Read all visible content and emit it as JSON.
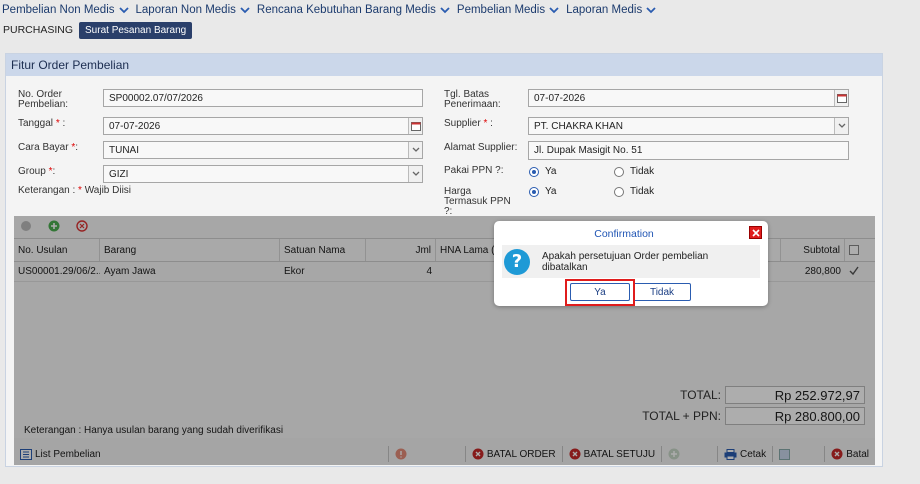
{
  "menu": {
    "items": [
      "Pembelian Non Medis",
      "Laporan Non Medis",
      "Rencana Kebutuhan Barang Medis",
      "Pembelian Medis",
      "Laporan Medis"
    ]
  },
  "subbar": {
    "section": "PURCHASING",
    "active_tab": "Surat Pesanan Barang"
  },
  "panel": {
    "title": "Fitur Order Pembelian"
  },
  "form": {
    "no_order_label": "No. Order Pembelian:",
    "no_order_value": "SP00002.07/07/2026",
    "tanggal_label": "Tanggal",
    "tanggal_value": "07-07-2026",
    "cara_bayar_label": "Cara Bayar",
    "cara_bayar_value": "TUNAI",
    "group_label": "Group",
    "group_value": "GIZI",
    "keterangan_label": "Keterangan :",
    "wajib_diisi": "Wajib Diisi",
    "tgl_batas_label": "Tgl. Batas Penerimaan:",
    "tgl_batas_value": "07-07-2026",
    "supplier_label": "Supplier",
    "supplier_value": "PT. CHAKRA KHAN",
    "alamat_label": "Alamat Supplier:",
    "alamat_value": "Jl. Dupak Masigit No. 51",
    "pakai_ppn_label": "Pakai PPN ?:",
    "harga_ppn_label": "Harga Termasuk PPN ?:",
    "opt_ya": "Ya",
    "opt_tidak": "Tidak",
    "required_mark": "*",
    "colon": ":"
  },
  "grid": {
    "columns": [
      "No. Usulan",
      "Barang",
      "Satuan Nama",
      "Jml",
      "HNA Lama (",
      "Subtotal"
    ],
    "rows": [
      {
        "no_usulan": "US00001.29/06/2...",
        "barang": "Ayam Jawa",
        "satuan": "Ekor",
        "jml": "4",
        "subtotal": "280,800"
      }
    ],
    "total_label": "TOTAL:",
    "total_value": "Rp 252.972,97",
    "total_ppn_label": "TOTAL + PPN:",
    "total_ppn_value": "Rp 280.800,00",
    "note": "Keterangan : Hanya usulan barang yang sudah diverifikasi"
  },
  "bottombar": {
    "list": "List Pembelian",
    "batal_order": "BATAL ORDER",
    "batal_setuju": "BATAL SETUJU",
    "cetak": "Cetak",
    "batal": "Batal"
  },
  "dialog": {
    "title": "Confirmation",
    "message": "Apakah persetujuan Order pembelian dibatalkan",
    "yes": "Ya",
    "no": "Tidak"
  },
  "colors": {
    "accent": "#2a3f6a",
    "danger": "#e01c1c",
    "info": "#1f9ad6"
  }
}
